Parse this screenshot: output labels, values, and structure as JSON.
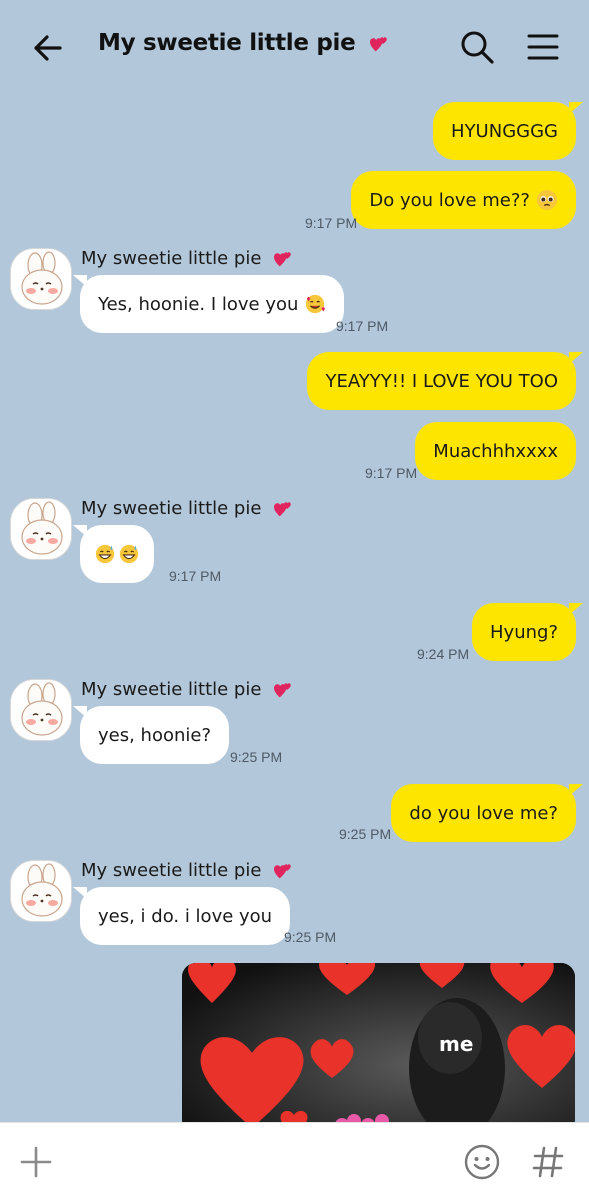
{
  "header": {
    "title": "My sweetie little pie",
    "icons": {
      "back": "arrow-left-icon",
      "search": "search-icon",
      "menu": "hamburger-menu-icon",
      "title_emoji": "two-hearts-emoji"
    }
  },
  "contact_name": "My sweetie little pie",
  "messages": [
    {
      "dir": "out",
      "text": "HYUNGGGG"
    },
    {
      "dir": "out",
      "text": "Do you love me??",
      "emoji": "pleading-face-emoji",
      "time": "9:17 PM"
    },
    {
      "dir": "in",
      "sender": "My sweetie little pie",
      "text": "Yes, hoonie. I love you",
      "emoji": "smiling-face-with-hearts-emoji",
      "time": "9:17 PM"
    },
    {
      "dir": "out",
      "text": "YEAYYY!! I LOVE YOU TOO"
    },
    {
      "dir": "out",
      "text": "Muachhhxxxx",
      "time": "9:17 PM"
    },
    {
      "dir": "in",
      "sender": "My sweetie little pie",
      "text": "",
      "emoji": "grinning-sweat-emoji x2",
      "time": "9:17 PM"
    },
    {
      "dir": "out",
      "text": "Hyung?",
      "time": "9:24 PM"
    },
    {
      "dir": "in",
      "sender": "My sweetie little pie",
      "text": "yes, hoonie?",
      "time": "9:25 PM"
    },
    {
      "dir": "out",
      "text": "do you love me?",
      "time": "9:25 PM"
    },
    {
      "dir": "in",
      "sender": "My sweetie little pie",
      "text": "yes, i do. i love you",
      "time": "9:25 PM"
    },
    {
      "dir": "out",
      "type": "image",
      "caption": "me"
    }
  ],
  "bottom_bar": {
    "icons": [
      "plus-icon",
      "emoji-smile-icon",
      "hashtag-icon"
    ]
  },
  "colors": {
    "background": "#b2c7d9",
    "outgoing": "#fee500",
    "incoming": "#ffffff",
    "time": "#4e5a66"
  }
}
